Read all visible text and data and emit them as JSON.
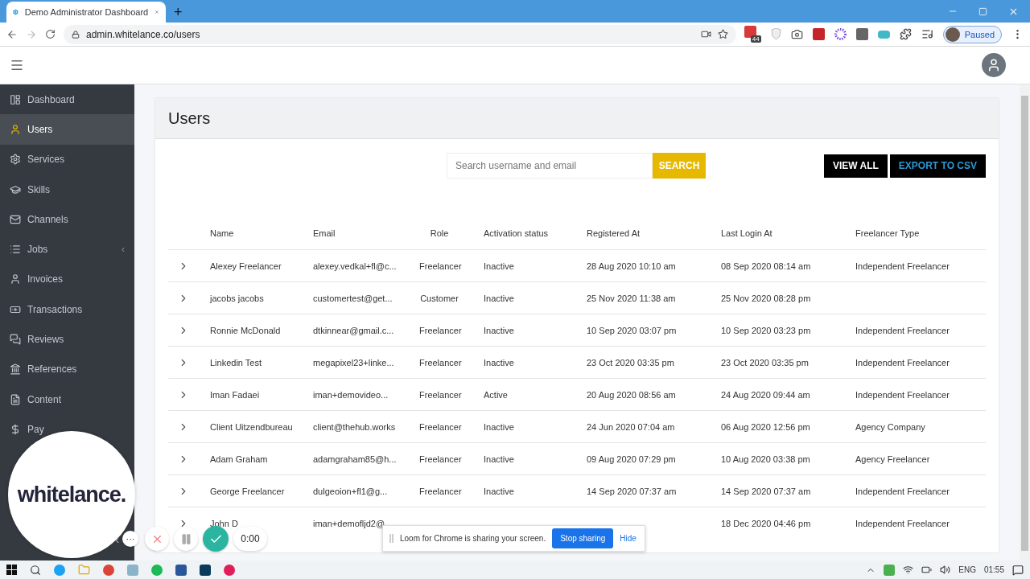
{
  "browser": {
    "tab_title": "Demo Administrator Dashboard",
    "new_tab": "+",
    "url": "admin.whitelance.co/users",
    "extension_badge": "44",
    "profile": "Paused"
  },
  "sidebar": {
    "items": [
      {
        "label": "Dashboard",
        "selected": false
      },
      {
        "label": "Users",
        "selected": true
      },
      {
        "label": "Services",
        "selected": false
      },
      {
        "label": "Skills",
        "selected": false
      },
      {
        "label": "Channels",
        "selected": false
      },
      {
        "label": "Jobs",
        "selected": false,
        "caret": "‹"
      },
      {
        "label": "Invoices",
        "selected": false
      },
      {
        "label": "Transactions",
        "selected": false
      },
      {
        "label": "Reviews",
        "selected": false
      },
      {
        "label": "References",
        "selected": false
      },
      {
        "label": "Content",
        "selected": false
      },
      {
        "label": "Pay",
        "selected": false
      }
    ],
    "collapse": "‹"
  },
  "page": {
    "title": "Users",
    "search": {
      "placeholder": "Search username and email",
      "button": "SEARCH"
    },
    "actions": [
      "VIEW ALL",
      "EXPORT TO CSV"
    ]
  },
  "table": {
    "columns": [
      "Name",
      "Email",
      "Role",
      "Activation status",
      "Registered At",
      "Last Login At",
      "Freelancer Type"
    ],
    "rows": [
      {
        "cells": [
          "Alexey Freelancer",
          "alexey.vedkal+fl@c...",
          "Freelancer",
          "Inactive",
          "28 Aug 2020 10:10 am",
          "08 Sep 2020 08:14 am",
          "Independent Freelancer"
        ]
      },
      {
        "cells": [
          "jacobs jacobs",
          "customertest@get...",
          "Customer",
          "Inactive",
          "25 Nov 2020 11:38 am",
          "25 Nov 2020 08:28 pm",
          null
        ]
      },
      {
        "cells": [
          "Ronnie McDonald",
          "dtkinnear@gmail.c...",
          "Freelancer",
          "Inactive",
          "10 Sep 2020 03:07 pm",
          "10 Sep 2020 03:23 pm",
          "Independent Freelancer"
        ]
      },
      {
        "cells": [
          "Linkedin Test",
          "megapixel23+linke...",
          "Freelancer",
          "Inactive",
          "23 Oct 2020 03:35 pm",
          "23 Oct 2020 03:35 pm",
          "Independent Freelancer"
        ]
      },
      {
        "cells": [
          "Iman Fadaei",
          "iman+demovideo...",
          "Freelancer",
          "Active",
          "20 Aug 2020 08:56 am",
          "24 Aug 2020 09:44 am",
          "Independent Freelancer"
        ]
      },
      {
        "cells": [
          "Client Uitzendbureau",
          "client@thehub.works",
          "Freelancer",
          "Inactive",
          "24 Jun 2020 07:04 am",
          "06 Aug 2020 12:56 pm",
          "Agency Company"
        ]
      },
      {
        "cells": [
          "Adam Graham",
          "adamgraham85@h...",
          "Freelancer",
          "Inactive",
          "09 Aug 2020 07:29 pm",
          "10 Aug 2020 03:38 pm",
          "Agency Freelancer"
        ]
      },
      {
        "cells": [
          "George Freelancer",
          "dulgeoion+fl1@g...",
          "Freelancer",
          "Inactive",
          "14 Sep 2020 07:37 am",
          "14 Sep 2020 07:37 am",
          "Independent Freelancer"
        ]
      },
      {
        "cells": [
          "John D",
          "iman+demofljd2@",
          null,
          null,
          null,
          "18 Dec 2020 04:46 pm",
          "Independent Freelancer"
        ]
      }
    ]
  },
  "loom": {
    "logo": "whitelance.",
    "more": "···",
    "timer": "0:00",
    "banner": {
      "text": "Loom for Chrome is sharing your screen.",
      "stop": "Stop sharing",
      "hide": "Hide"
    }
  },
  "taskbar": {
    "language": "ENG",
    "time": "01:55"
  }
}
